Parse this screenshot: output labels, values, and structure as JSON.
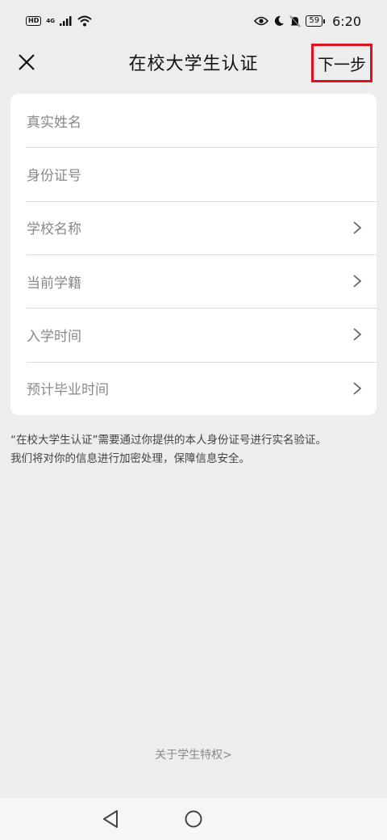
{
  "status_bar": {
    "hd": "HD",
    "network": "4G",
    "battery": "59",
    "time": "6:20",
    "icons": [
      "signal-icon",
      "wifi-icon",
      "eye-icon",
      "moon-icon",
      "bell-muted-icon"
    ]
  },
  "nav": {
    "title": "在校大学生认证",
    "next_label": "下一步",
    "close_icon": "close-icon",
    "highlight_color": "#e0101e"
  },
  "form": {
    "fields": [
      {
        "label": "真实姓名",
        "has_arrow": false
      },
      {
        "label": "身份证号",
        "has_arrow": false
      },
      {
        "label": "学校名称",
        "has_arrow": true
      },
      {
        "label": "当前学籍",
        "has_arrow": true
      },
      {
        "label": "入学时间",
        "has_arrow": true
      },
      {
        "label": "预计毕业时间",
        "has_arrow": true
      }
    ]
  },
  "notice": {
    "line1": "“在校大学生认证”需要通过你提供的本人身份证号进行实名验证。",
    "line2": "我们将对你的信息进行加密处理，保障信息安全。"
  },
  "footer": {
    "privilege_link": "关于学生特权>"
  },
  "system_nav": {
    "icons": [
      "back-triangle-icon",
      "home-circle-icon"
    ]
  }
}
